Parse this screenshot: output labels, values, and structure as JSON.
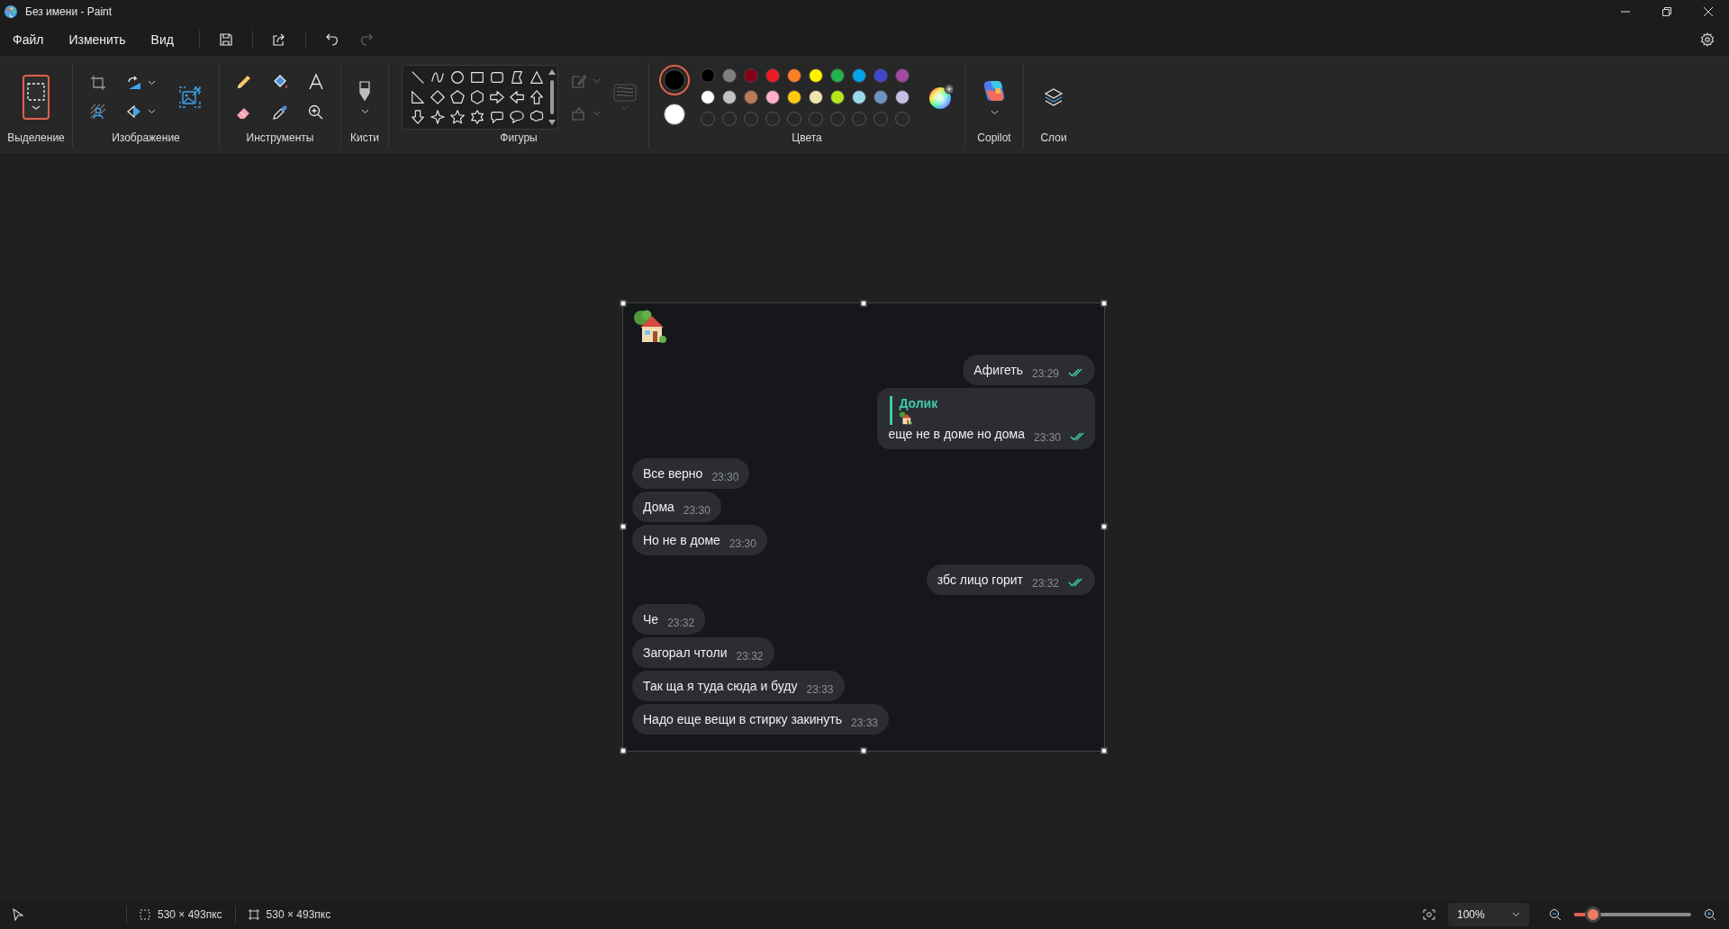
{
  "window": {
    "title": "Без имени - Paint"
  },
  "menu": [
    {
      "label": "Файл"
    },
    {
      "label": "Изменить"
    },
    {
      "label": "Вид"
    }
  ],
  "ribbon": [
    {
      "kind": "selection",
      "label": "Выделение",
      "selected": true
    },
    {
      "kind": "image",
      "label": "Изображение"
    },
    {
      "kind": "tools",
      "label": "Инструменты"
    },
    {
      "kind": "brushes",
      "label": "Кисти"
    },
    {
      "kind": "shapes",
      "label": "Фигуры"
    },
    {
      "kind": "colors",
      "label": "Цвета"
    },
    {
      "kind": "copilot",
      "label": "Copilot"
    },
    {
      "kind": "layers",
      "label": "Слои"
    }
  ],
  "palette": {
    "primary": {
      "color": "#000000",
      "selected": true
    },
    "secondary": {
      "color": "#ffffff",
      "selected": false
    },
    "colors": [
      {
        "color": "#000000"
      },
      {
        "color": "#7f7f7f"
      },
      {
        "color": "#880015"
      },
      {
        "color": "#ed1c24"
      },
      {
        "color": "#ff7f27"
      },
      {
        "color": "#fff200"
      },
      {
        "color": "#22b14c"
      },
      {
        "color": "#00a2e8"
      },
      {
        "color": "#3f48cc"
      },
      {
        "color": "#a349a4"
      },
      {
        "color": "#ffffff"
      },
      {
        "color": "#c3c3c3"
      },
      {
        "color": "#b97a57"
      },
      {
        "color": "#ffaec9"
      },
      {
        "color": "#ffc90e"
      },
      {
        "color": "#efe4b0"
      },
      {
        "color": "#b5e61d"
      },
      {
        "color": "#99d9ea"
      },
      {
        "color": "#7092be"
      },
      {
        "color": "#c8bfe7"
      }
    ]
  },
  "chat": {
    "messages": [
      {
        "kind": "sticker"
      },
      {
        "kind": "text",
        "outgoing": true,
        "text": "Афигеть",
        "time": "23:29",
        "read": true
      },
      {
        "kind": "reply",
        "outgoing": true,
        "reply_author": "Долик",
        "text": "еще не в доме но дома",
        "time": "23:30",
        "read": true
      },
      {
        "kind": "text",
        "outgoing": false,
        "text": "Все верно",
        "time": "23:30"
      },
      {
        "kind": "text",
        "outgoing": false,
        "text": "Дома",
        "time": "23:30"
      },
      {
        "kind": "text",
        "outgoing": false,
        "text": "Но не в доме",
        "time": "23:30"
      },
      {
        "kind": "text",
        "outgoing": true,
        "text": "збс лицо горит",
        "time": "23:32",
        "read": true
      },
      {
        "kind": "text",
        "outgoing": false,
        "text": "Че",
        "time": "23:32"
      },
      {
        "kind": "text",
        "outgoing": false,
        "text": "Загорал чтоли",
        "time": "23:32"
      },
      {
        "kind": "text",
        "outgoing": false,
        "text": "Так ща я туда сюда и буду",
        "time": "23:33"
      },
      {
        "kind": "text",
        "outgoing": false,
        "text": "Надо еще вещи в стирку закинуть",
        "time": "23:33"
      }
    ]
  },
  "status_bar": {
    "selection_size": "530 × 493пкс",
    "canvas_size": "530 × 493пкс",
    "zoom": "100%",
    "zoom_slider": {
      "level": 0.16
    }
  }
}
